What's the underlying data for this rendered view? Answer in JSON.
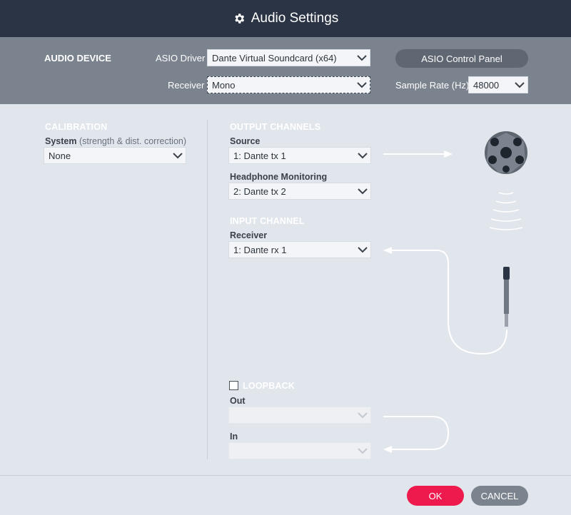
{
  "window": {
    "title": "Audio Settings"
  },
  "audio_device": {
    "heading": "AUDIO DEVICE",
    "asio_driver_label": "ASIO Driver",
    "asio_driver_value": "Dante Virtual Soundcard (x64)",
    "receiver_label": "Receiver",
    "receiver_value": "Mono",
    "asio_control_panel_label": "ASIO Control Panel",
    "sample_rate_label": "Sample Rate (Hz)",
    "sample_rate_value": "48000"
  },
  "calibration": {
    "heading": "CALIBRATION",
    "system_label": "System",
    "system_hint": "(strength & dist. correction)",
    "system_value": "None"
  },
  "output_channels": {
    "heading": "OUTPUT CHANNELS",
    "source_label": "Source",
    "source_value": "1: Dante tx 1",
    "headphone_label": "Headphone Monitoring",
    "headphone_value": "2: Dante tx 2"
  },
  "input_channel": {
    "heading": "INPUT CHANNEL",
    "receiver_label": "Receiver",
    "receiver_value": "1: Dante rx 1"
  },
  "loopback": {
    "label": "LOOPBACK",
    "checked": false,
    "out_label": "Out",
    "out_value": "",
    "in_label": "In",
    "in_value": ""
  },
  "footer": {
    "ok_label": "OK",
    "cancel_label": "CANCEL"
  },
  "colors": {
    "titlebar": "#2a3444",
    "devicebar": "#7b838f",
    "ok": "#ee1a4d",
    "cancel": "#7b838f"
  }
}
